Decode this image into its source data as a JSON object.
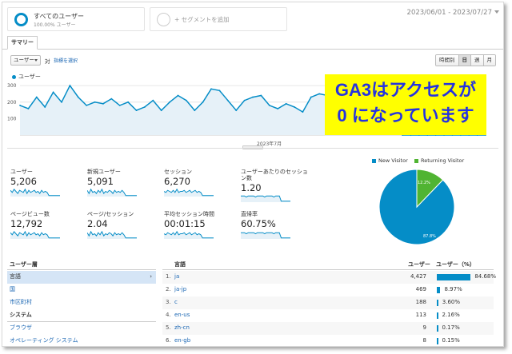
{
  "segments": {
    "all_users_title": "すべてのユーザー",
    "all_users_sub": "100.00% ユーザー",
    "add_segment": "+ セグメントを追加"
  },
  "date_range": "2023/06/01 - 2023/07/27",
  "tab_summary": "サマリー",
  "controls": {
    "metric_select": "ユーザー",
    "versus": "対",
    "pick_metric": "指標を選択",
    "granularity": [
      "時間別",
      "日",
      "週",
      "月"
    ],
    "granularity_active": "日"
  },
  "chart_legend": "ユーザー",
  "chart_data": {
    "type": "area",
    "series": [
      {
        "name": "ユーザー",
        "values": [
          180,
          160,
          230,
          170,
          260,
          200,
          300,
          230,
          180,
          200,
          190,
          220,
          180,
          200,
          150,
          170,
          210,
          150,
          200,
          240,
          210,
          150,
          200,
          280,
          270,
          210,
          150,
          210,
          230,
          240,
          180,
          160,
          190,
          170,
          140,
          230,
          250,
          240,
          160,
          150,
          230,
          200,
          260,
          150,
          190,
          120,
          0,
          0,
          0,
          0,
          0,
          0,
          0,
          0,
          0,
          0,
          0
        ]
      }
    ],
    "yticks": [
      "300",
      "200",
      "100"
    ],
    "ylim": [
      0,
      320
    ],
    "xlabel": "2023年7月",
    "color": "#058dc7"
  },
  "overlay": {
    "line1": "GA3はアクセスが",
    "line2": "0 になっています",
    "bg": "#ffff00",
    "text_color": "#2533e0"
  },
  "metrics": [
    {
      "label": "ユーザー",
      "value": "5,206"
    },
    {
      "label": "新規ユーザー",
      "value": "5,091"
    },
    {
      "label": "セッション",
      "value": "6,270"
    },
    {
      "label": "ユーザーあたりのセッション数",
      "value": "1.20"
    },
    {
      "label": "ページビュー数",
      "value": "12,792"
    },
    {
      "label": "ページ/セッション",
      "value": "2.04"
    },
    {
      "label": "平均セッション時間",
      "value": "00:01:15"
    },
    {
      "label": "直帰率",
      "value": "60.75%"
    }
  ],
  "pie": {
    "legend": [
      {
        "name": "New Visitor",
        "color": "#058dc7"
      },
      {
        "name": "Returning Visitor",
        "color": "#50b432"
      }
    ],
    "new_pct_label": "87.8%",
    "returning_pct_label": "12.2%",
    "returning_fraction": 0.122
  },
  "left_panel": {
    "header": "ユーザー層",
    "rows": [
      "言語",
      "国",
      "市区町村"
    ],
    "system_header": "システム",
    "system_rows": [
      "ブラウザ",
      "オペレーティング システム"
    ]
  },
  "table": {
    "col_lang": "言語",
    "col_users": "ユーザー",
    "col_pct": "ユーザー（%）",
    "rows": [
      {
        "idx": "1.",
        "lang": "ja",
        "users": "4,427",
        "pct": "84.68%",
        "frac": 0.8468
      },
      {
        "idx": "2.",
        "lang": "ja-jp",
        "users": "469",
        "pct": "8.97%",
        "frac": 0.0897
      },
      {
        "idx": "3.",
        "lang": "c",
        "users": "188",
        "pct": "3.60%",
        "frac": 0.036
      },
      {
        "idx": "4.",
        "lang": "en-us",
        "users": "113",
        "pct": "2.16%",
        "frac": 0.0216
      },
      {
        "idx": "5.",
        "lang": "zh-cn",
        "users": "9",
        "pct": "0.17%",
        "frac": 0.0017
      },
      {
        "idx": "6.",
        "lang": "en-gb",
        "users": "8",
        "pct": "0.15%",
        "frac": 0.0015
      }
    ]
  }
}
